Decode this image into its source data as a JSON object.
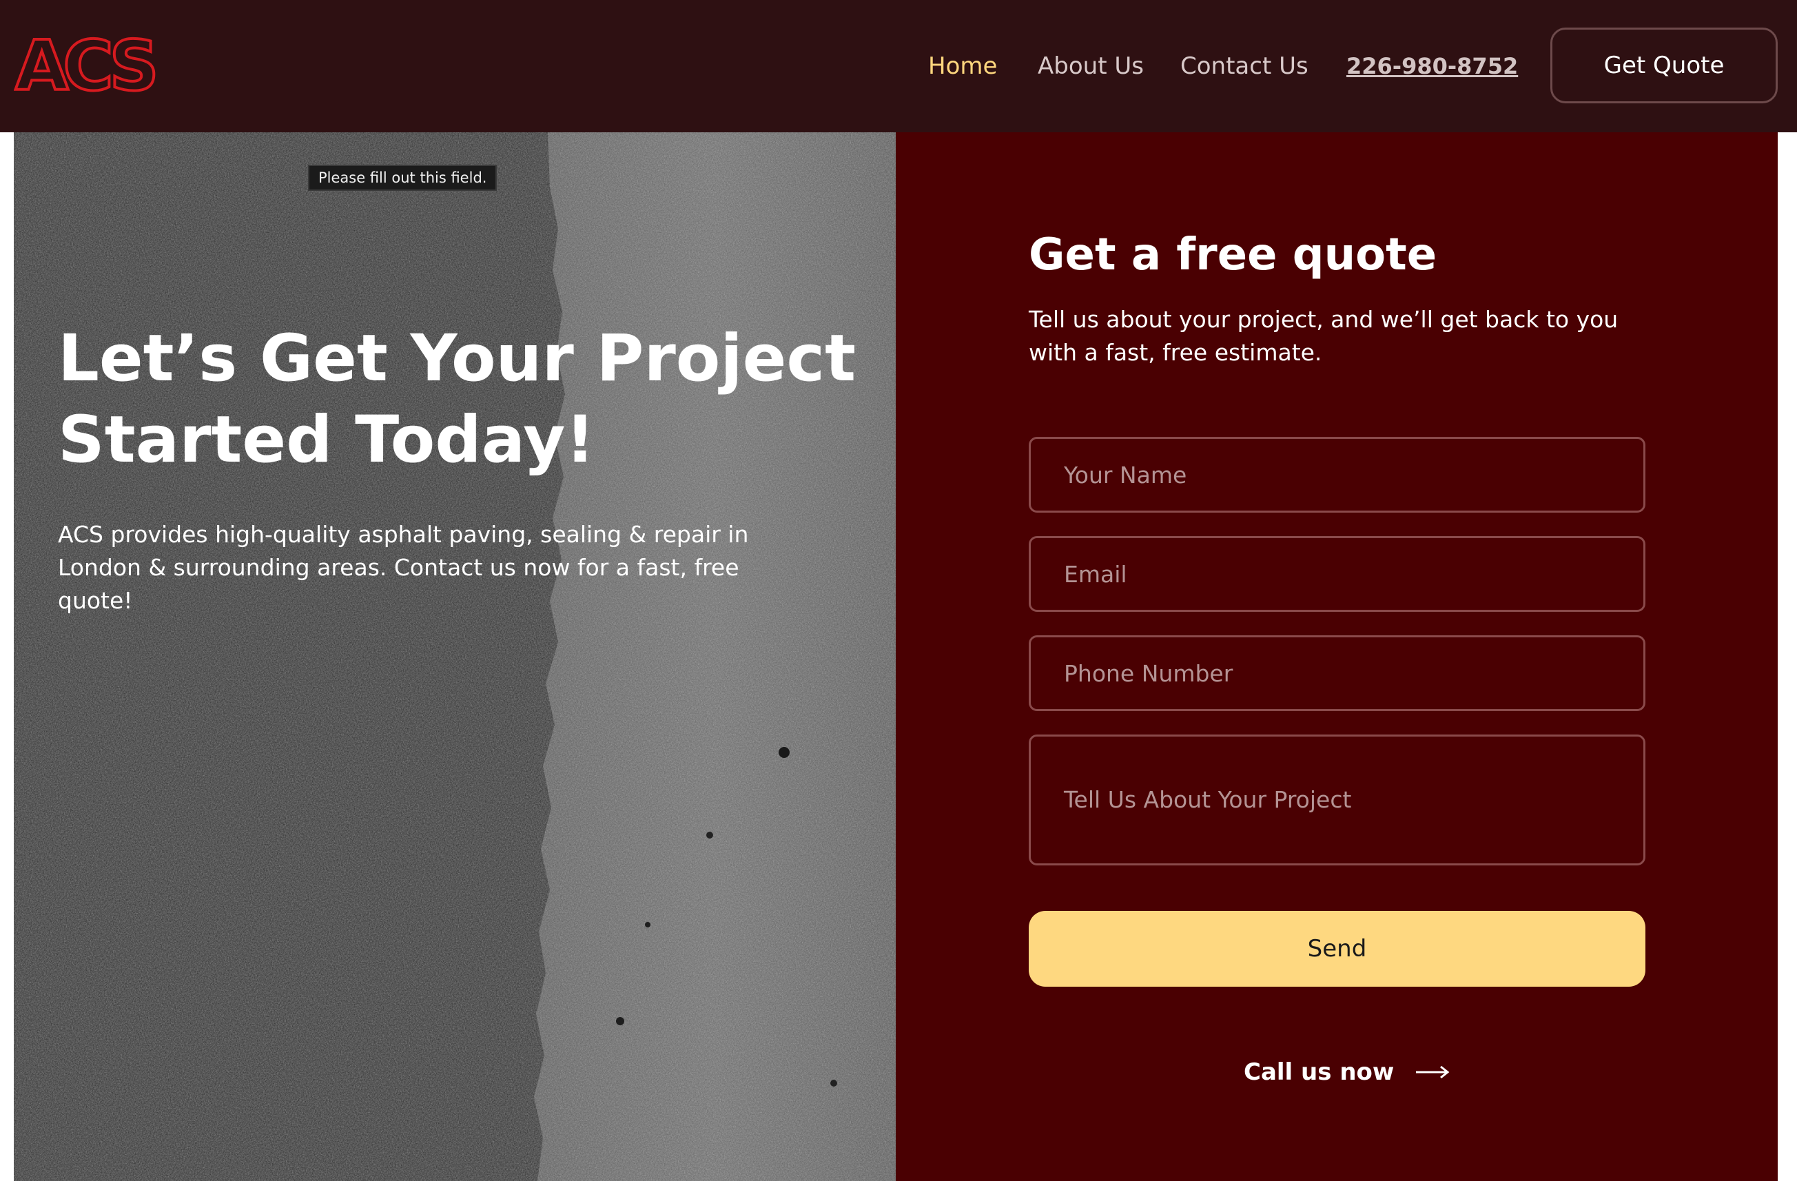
{
  "header": {
    "logo_text": "ACS",
    "nav": {
      "home": "Home",
      "about": "About Us",
      "contact": "Contact Us"
    },
    "phone": "226-980-8752",
    "cta_label": "Get Quote"
  },
  "hero": {
    "validation_tooltip": "Please fill out this field.",
    "title": "Let’s Get Your Project Started Today!",
    "text": "ACS provides high-quality asphalt paving, sealing & repair in London & surrounding areas. Contact us now for a fast, free quote!"
  },
  "form": {
    "title": "Get a free quote",
    "subtitle": "Tell us about your project, and we’ll get back to you with a fast, free estimate.",
    "name_placeholder": "Your Name",
    "email_placeholder": "Email",
    "phone_placeholder": "Phone Number",
    "project_placeholder": "Tell Us About Your Project",
    "send_label": "Send",
    "call_label": "Call us now",
    "call_icon": "arrow-right-icon"
  },
  "colors": {
    "header_bg": "#2e1012",
    "form_bg": "#4a0002",
    "accent_yellow": "#fed880",
    "logo_red": "#d71a1f"
  }
}
